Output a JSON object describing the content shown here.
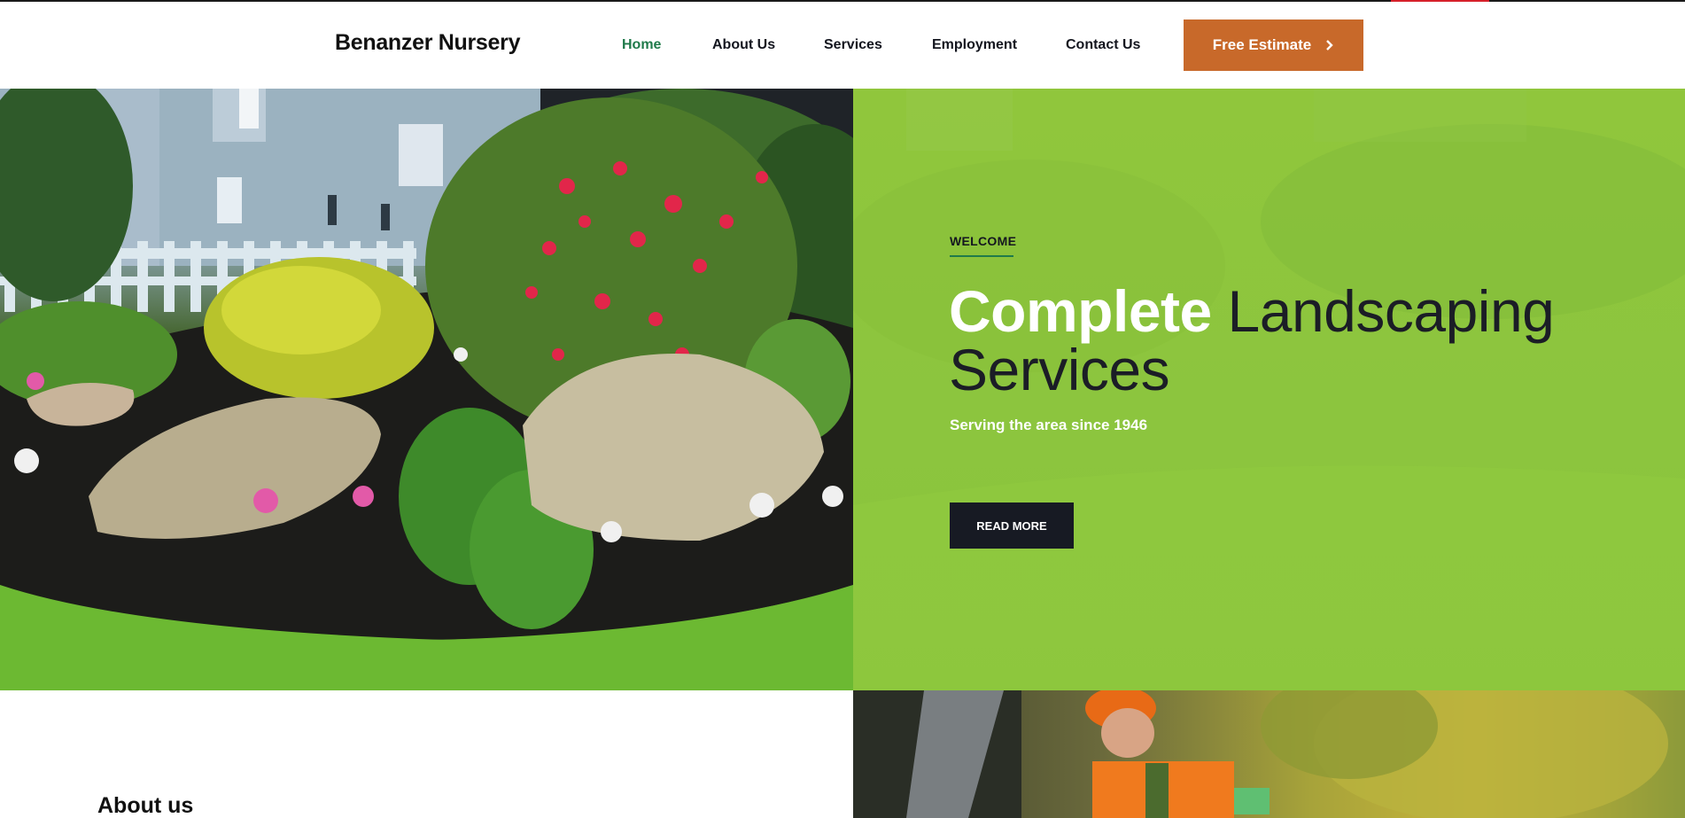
{
  "header": {
    "logo": "Benanzer Nursery",
    "nav": [
      {
        "label": "Home",
        "active": true
      },
      {
        "label": "About Us",
        "active": false
      },
      {
        "label": "Services",
        "active": false
      },
      {
        "label": "Employment",
        "active": false
      },
      {
        "label": "Contact Us",
        "active": false
      }
    ],
    "cta_label": "Free Estimate",
    "cta_icon": "chevron-right-icon"
  },
  "hero": {
    "eyebrow": "WELCOME",
    "headline_strong": "Complete",
    "headline_rest": " Landscaping Services",
    "subline": "Serving the area since 1946",
    "button_label": "READ MORE",
    "photo": "garden bed with rocks, red rose bush, white and pink flowers, house and picket fence",
    "colors": {
      "panel": "#8cc53e",
      "accent": "#1f7a4a",
      "button": "#171a23",
      "cta": "#c8692a"
    }
  },
  "about": {
    "title": "About us",
    "photo": "landscaper in orange hard hat trimming a hedge"
  }
}
